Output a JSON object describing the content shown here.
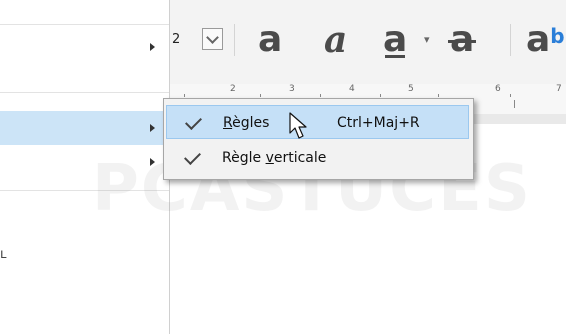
{
  "toolbar": {
    "font_size_value": "2",
    "bold_glyph": "a",
    "italic_glyph": "a",
    "underline_glyph": "a",
    "underline_drop_glyph": "▾",
    "strike_glyph": "a",
    "super_glyph": "a",
    "super_mark": "b"
  },
  "ruler": {
    "numbers": [
      "2",
      "3",
      "4",
      "5",
      "6",
      "7"
    ]
  },
  "context_menu": {
    "items": [
      {
        "label_prefix": "",
        "label_mnemonic": "R",
        "label_suffix": "ègles",
        "shortcut": "Ctrl+Maj+R",
        "checked": true,
        "highlighted": true
      },
      {
        "label_prefix": "Règle ",
        "label_mnemonic": "v",
        "label_suffix": "erticale",
        "shortcut": "",
        "checked": true,
        "highlighted": false
      }
    ]
  },
  "left_stub_glyph": "ʟ",
  "watermark_text": "PCASTUCES",
  "colors": {
    "highlight": "#c5e0f7",
    "left_highlight": "#cce4f7",
    "superscript": "#2a7ed8"
  },
  "icons": [
    "check-icon",
    "chevron-down-icon",
    "submenu-arrow-icon",
    "mouse-cursor-icon"
  ]
}
